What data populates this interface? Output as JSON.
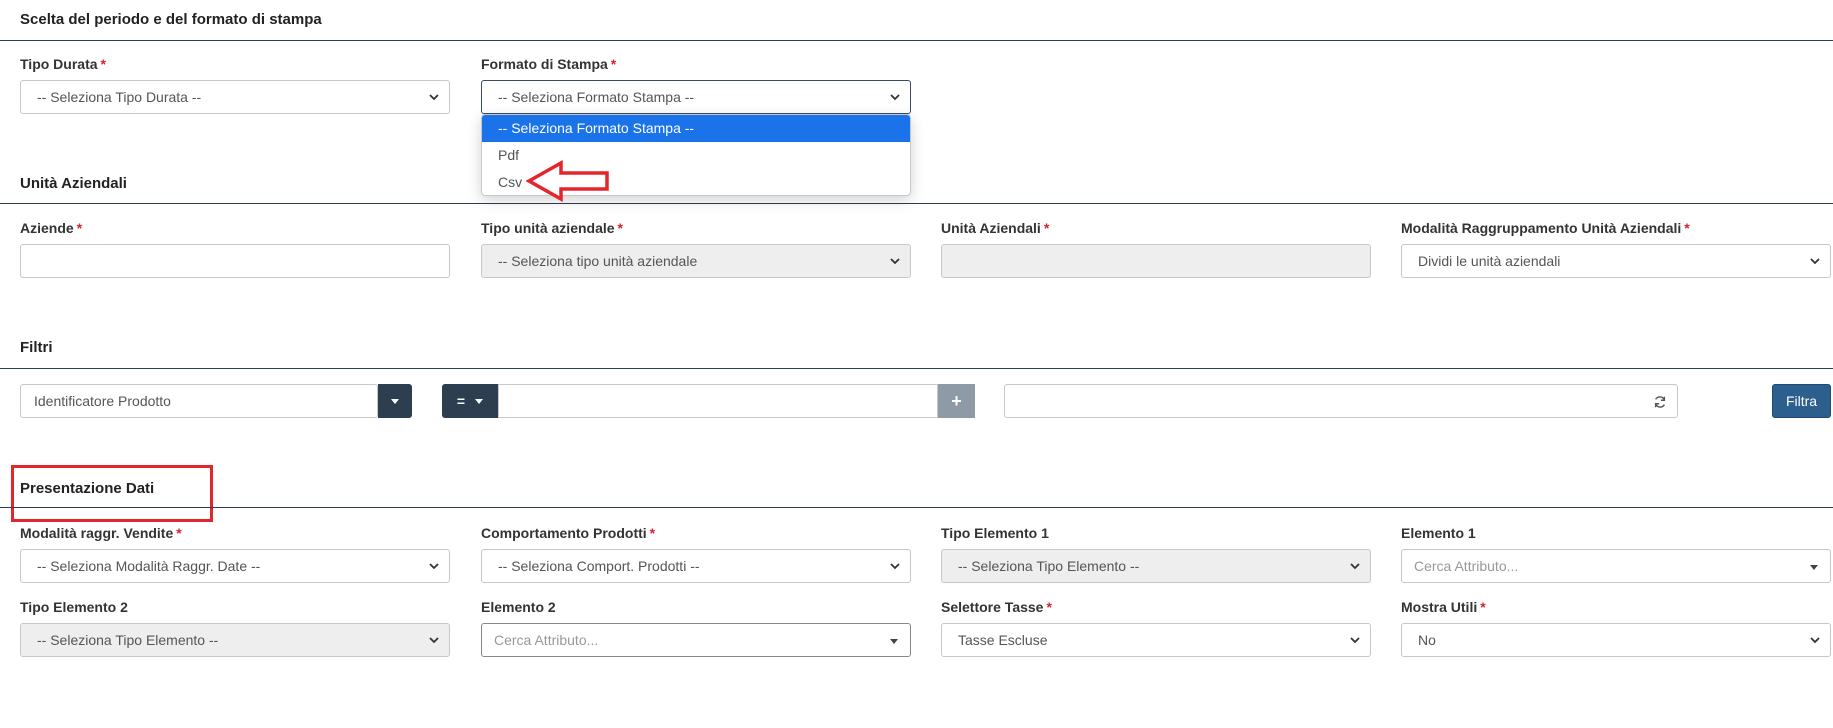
{
  "sections": {
    "period": "Scelta del periodo e del formato di stampa",
    "units": "Unità Aziendali",
    "filters": "Filtri",
    "presentation": "Presentazione Dati"
  },
  "period": {
    "tipo_durata_label": "Tipo Durata",
    "tipo_durata_value": "-- Seleziona Tipo Durata --",
    "formato_label": "Formato di Stampa",
    "formato_value": "-- Seleziona Formato Stampa --",
    "formato_options": [
      "-- Seleziona Formato Stampa --",
      "Pdf",
      "Csv"
    ]
  },
  "units": {
    "aziende_label": "Aziende",
    "aziende_value": "",
    "tipo_unita_label": "Tipo unità aziendale",
    "tipo_unita_value": "-- Seleziona tipo unità aziendale",
    "unita_label": "Unità Aziendali",
    "unita_value": "",
    "modalita_label": "Modalità Raggruppamento Unità Aziendali",
    "modalita_value": "Dividi le unità aziendali"
  },
  "filters": {
    "field_value": "Identificatore Prodotto",
    "operator": "=",
    "value_text": "",
    "add_symbol": "+",
    "result_text": "",
    "filtra_label": "Filtra"
  },
  "presentation": {
    "modalita_vendite_label": "Modalità raggr. Vendite",
    "modalita_vendite_value": "-- Seleziona Modalità Raggr. Date --",
    "comportamento_label": "Comportamento Prodotti",
    "comportamento_value": "-- Seleziona Comport. Prodotti --",
    "tipo_el1_label": "Tipo Elemento 1",
    "tipo_el1_value": "-- Seleziona Tipo Elemento --",
    "el1_label": "Elemento 1",
    "el1_placeholder": "Cerca Attributo...",
    "tipo_el2_label": "Tipo Elemento 2",
    "tipo_el2_value": "-- Seleziona Tipo Elemento --",
    "el2_label": "Elemento 2",
    "el2_placeholder": "Cerca Attributo...",
    "tasse_label": "Selettore Tasse",
    "tasse_value": "Tasse Escluse",
    "utili_label": "Mostra Utili",
    "utili_value": "No"
  },
  "required_marker": "*",
  "colors": {
    "accent_dark": "#2d3e50",
    "selected_option": "#1a73e8",
    "required": "#d9232d",
    "annotation": "#e3262c",
    "filtra_button": "#2c5f8d"
  },
  "icons": {
    "select_arrow": "chevron-down-icon",
    "refresh": "refresh-icon",
    "annotation": "arrow-left-icon"
  }
}
